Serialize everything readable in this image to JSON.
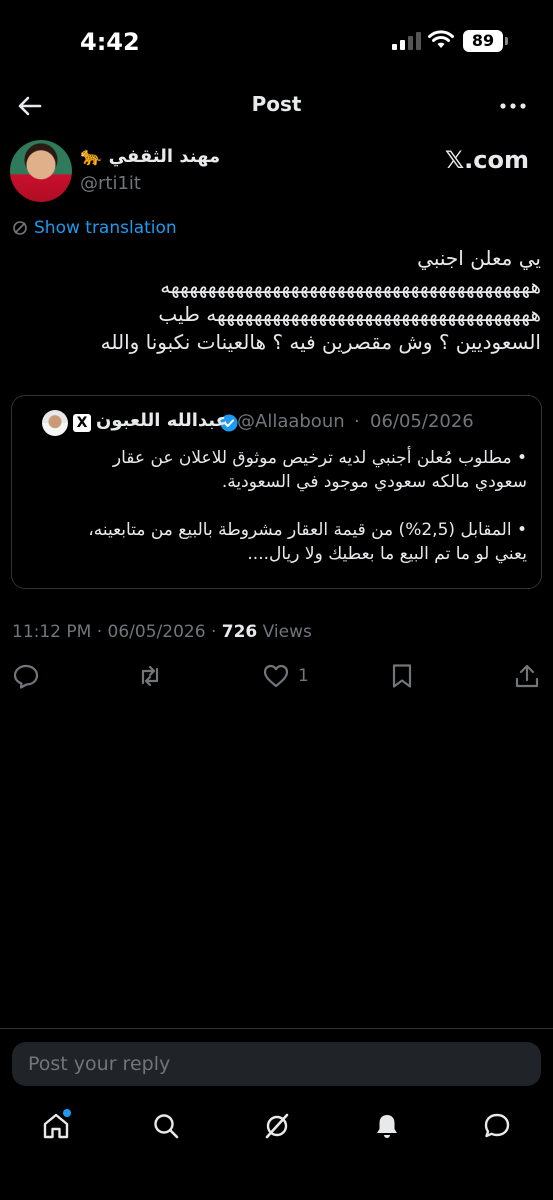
{
  "status": {
    "time": "4:42",
    "battery": "89"
  },
  "header": {
    "title": "Post"
  },
  "author": {
    "name": "مهند الثقفي 🐆",
    "handle": "@rti1it",
    "source": "𝕏.com"
  },
  "translation": {
    "label": "Show translation"
  },
  "tweet": {
    "text": "يي معلن اجنبي\nههههههههههههههههههههههههههههههههههههههههه\nهههههههههههههههههههههههههههههههههههه طيب\nالسعوديين ؟ وش مقصرين فيه ؟ هالعينات نكبونا والله"
  },
  "quote": {
    "name": "عبدالله اللعبون",
    "handle": "@Allaaboun",
    "separator": "·",
    "date": "06/05/2026",
    "badge": "X",
    "text": "• مطلوب مُعلن أجنبي لديه ترخيص موثوق للاعلان عن عقار\nسعودي مالكه سعودي موجود في السعودية.\n\n• المقابل (2,5%) من قيمة العقار مشروطة بالبيع من متابعينه،\nيعني لو ما تم البيع ما بعطيك ولا ريال...."
  },
  "meta": {
    "time": "11:12 PM",
    "date": "06/05/2026",
    "views_count": "726",
    "views_label": "Views",
    "sep1": "·",
    "sep2": "·"
  },
  "actions": {
    "like_count": "1"
  },
  "reply": {
    "placeholder": "Post your reply"
  },
  "colors": {
    "accent": "#1d9bf0",
    "background": "#000000",
    "secondary_text": "#71767b"
  }
}
